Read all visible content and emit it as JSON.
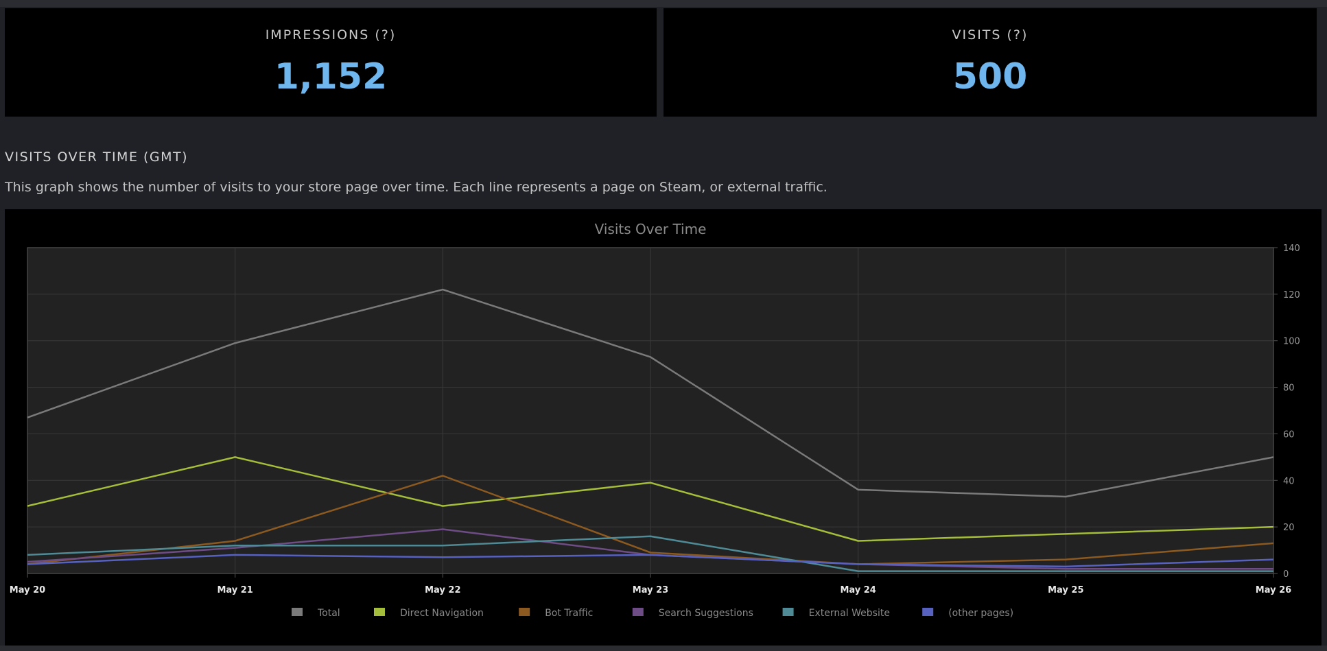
{
  "stats": {
    "impressions_label": "IMPRESSIONS (?)",
    "impressions_value": "1,152",
    "visits_label": "VISITS (?)",
    "visits_value": "500"
  },
  "section": {
    "title": "VISITS OVER TIME (GMT)",
    "description": "This graph shows the number of visits to your store page over time. Each line represents a page on Steam, or external traffic."
  },
  "colors": {
    "accent": "#6fb6ee",
    "plot_bg": "#222222",
    "grid": "#3a3a3a"
  },
  "chart_data": {
    "type": "line",
    "title": "Visits Over Time",
    "categories": [
      "May 20",
      "May 21",
      "May 22",
      "May 23",
      "May 24",
      "May 25",
      "May 26"
    ],
    "ylim": [
      0,
      140
    ],
    "yticks": [
      0,
      20,
      40,
      60,
      80,
      100,
      120,
      140
    ],
    "y_axis_side": "right",
    "grid": true,
    "legend_position": "bottom",
    "series": [
      {
        "name": "Total",
        "color": "#7a7a7a",
        "values": [
          67,
          99,
          122,
          93,
          36,
          33,
          50
        ]
      },
      {
        "name": "Direct Navigation",
        "color": "#a4bd3a",
        "values": [
          29,
          50,
          29,
          39,
          14,
          17,
          20
        ]
      },
      {
        "name": "Bot Traffic",
        "color": "#8c5a20",
        "values": [
          4,
          14,
          42,
          9,
          4,
          6,
          13
        ]
      },
      {
        "name": "Search Suggestions",
        "color": "#6e4d86",
        "values": [
          5,
          11,
          19,
          8,
          4,
          2,
          2
        ]
      },
      {
        "name": "External Website",
        "color": "#4e8b96",
        "values": [
          8,
          12,
          12,
          16,
          1,
          1,
          1
        ]
      },
      {
        "name": "(other pages)",
        "color": "#5761c0",
        "values": [
          4,
          8,
          7,
          8,
          4,
          3,
          6
        ]
      }
    ]
  }
}
